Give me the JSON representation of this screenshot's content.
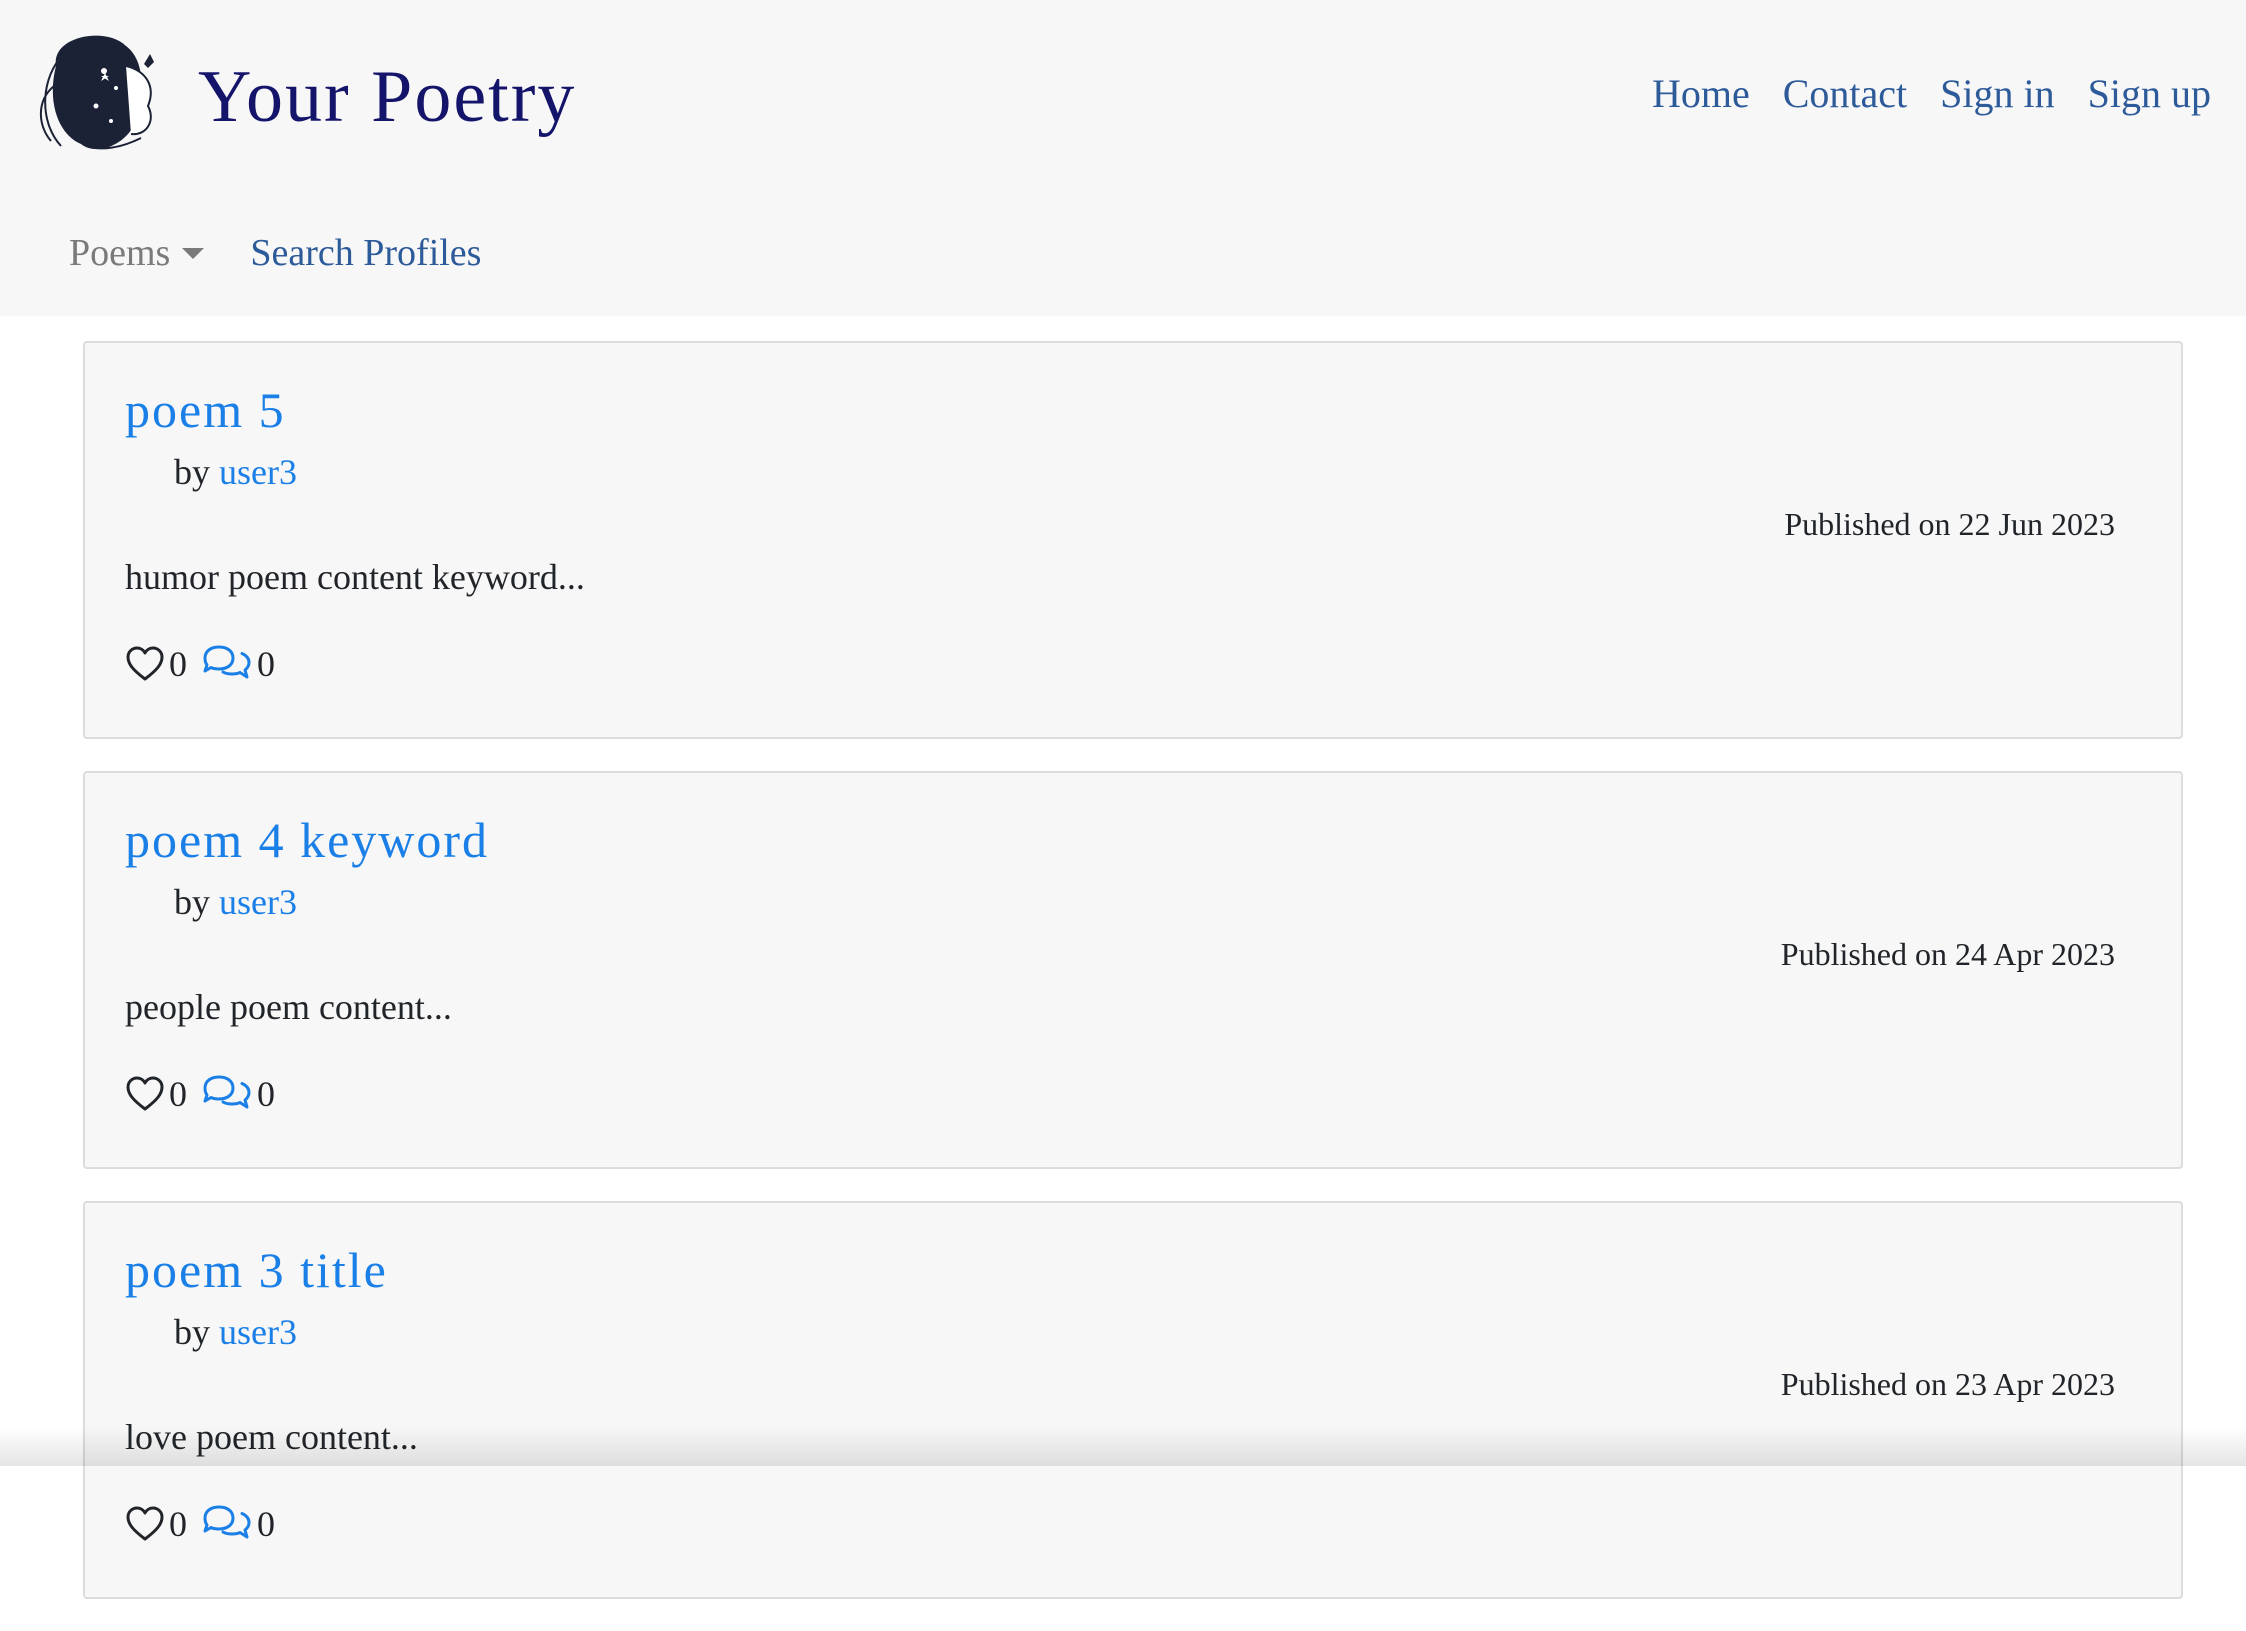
{
  "brand": {
    "title": "Your Poetry",
    "logo_icon": "woman-portrait-logo"
  },
  "topnav": {
    "items": [
      {
        "label": "Home"
      },
      {
        "label": "Contact"
      },
      {
        "label": "Sign in"
      },
      {
        "label": "Sign up"
      }
    ]
  },
  "subnav": {
    "dropdown_label": "Poems",
    "search_label": "Search Profiles"
  },
  "poems": [
    {
      "title": "poem 5",
      "by": "by",
      "author": "user3",
      "published": "Published on 22 Jun 2023",
      "excerpt": "humor poem content keyword...",
      "likes": "0",
      "comments": "0"
    },
    {
      "title": "poem 4 keyword",
      "by": "by",
      "author": "user3",
      "published": "Published on 24 Apr 2023",
      "excerpt": "people poem content...",
      "likes": "0",
      "comments": "0"
    },
    {
      "title": "poem 3 title",
      "by": "by",
      "author": "user3",
      "published": "Published on 23 Apr 2023",
      "excerpt": "love poem content...",
      "likes": "0",
      "comments": "0"
    }
  ],
  "colors": {
    "brand": "#14146b",
    "nav_link": "#2d5a99",
    "poem_link": "#1a7fe6",
    "card_bg": "#f7f7f7"
  },
  "icons": {
    "like": "heart-icon",
    "comment": "chat-bubbles-icon"
  }
}
